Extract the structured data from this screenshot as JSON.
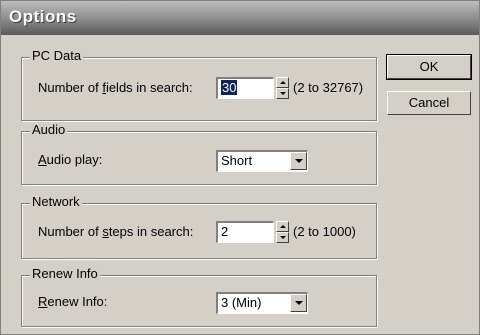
{
  "window": {
    "title": "Options"
  },
  "buttons": {
    "ok": "OK",
    "cancel": "Cancel"
  },
  "pc_data": {
    "legend": "PC Data",
    "label_pre": "Number of ",
    "label_key": "f",
    "label_post": "ields in search:",
    "value": "30",
    "range": "(2 to 32767)"
  },
  "audio": {
    "legend": "Audio",
    "label_key": "A",
    "label_post": "udio play:",
    "selected": "Short"
  },
  "network": {
    "legend": "Network",
    "label_pre": "Number of ",
    "label_key": "s",
    "label_post": "teps in search:",
    "value": "2",
    "range": "(2 to 1000)"
  },
  "renew": {
    "legend": "Renew Info",
    "label_key": "R",
    "label_post": "enew Info:",
    "selected": "3 (Min)"
  }
}
